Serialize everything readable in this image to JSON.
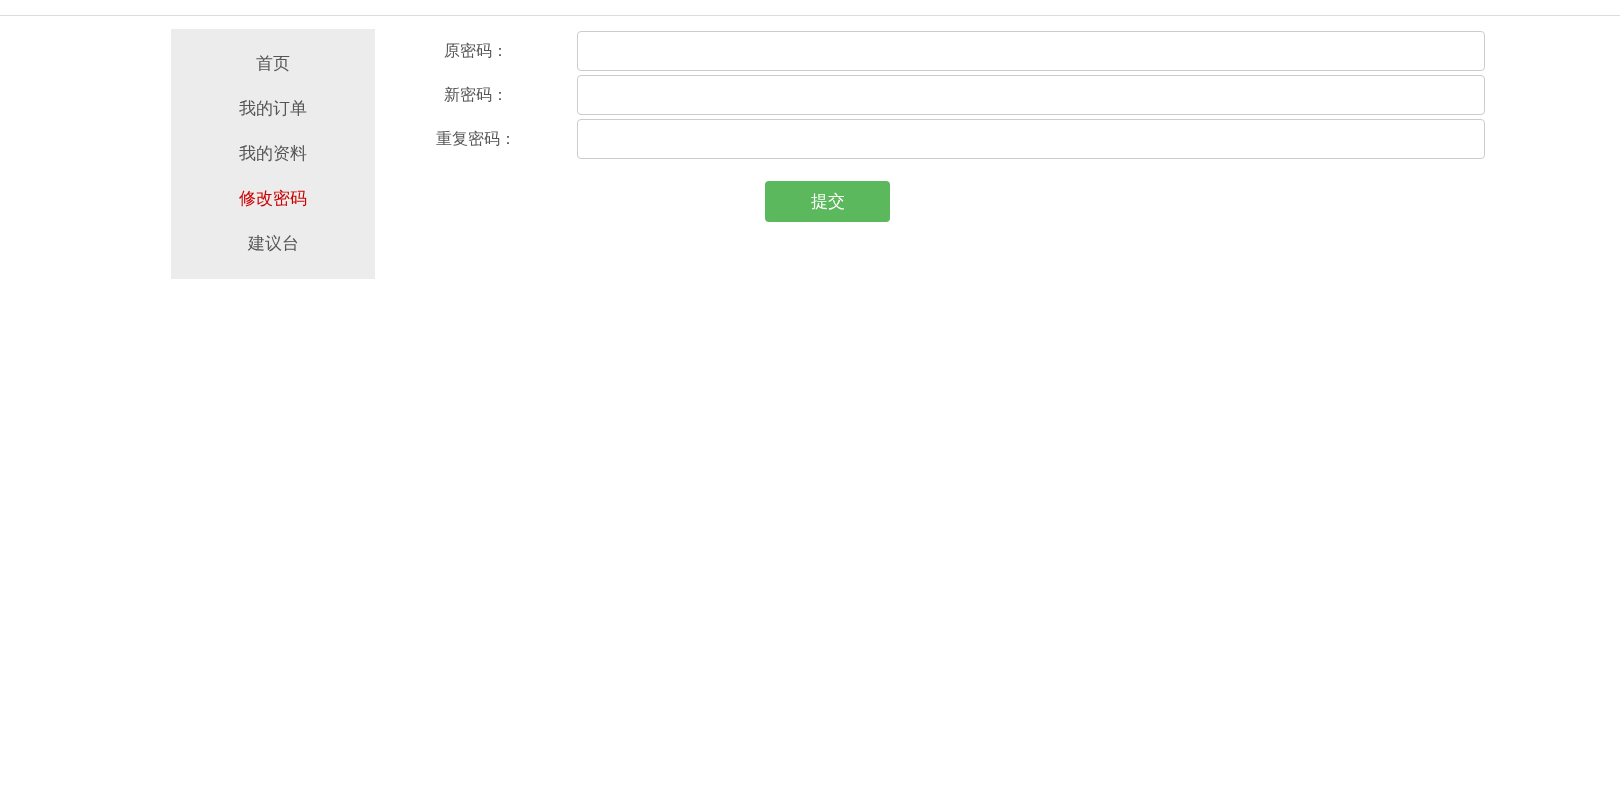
{
  "sidebar": {
    "items": [
      {
        "label": "首页",
        "selected": false
      },
      {
        "label": "我的订单",
        "selected": false
      },
      {
        "label": "我的资料",
        "selected": false
      },
      {
        "label": "修改密码",
        "selected": true
      },
      {
        "label": "建议台",
        "selected": false
      }
    ]
  },
  "form": {
    "fields": [
      {
        "label": "原密码："
      },
      {
        "label": "新密码："
      },
      {
        "label": "重复密码："
      }
    ],
    "submit_button": "提交"
  }
}
